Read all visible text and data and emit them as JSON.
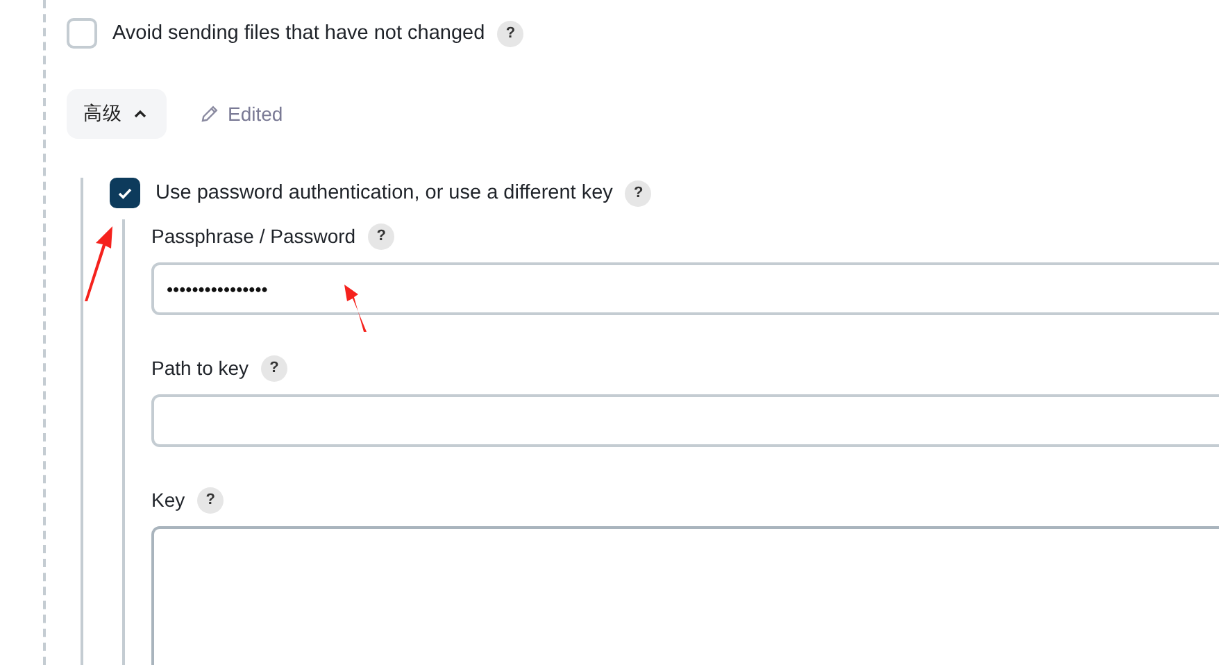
{
  "avoid_unchanged": {
    "label": "Avoid sending files that have not changed",
    "checked": false,
    "help": "?"
  },
  "advanced": {
    "label": "高级",
    "expanded": true,
    "edited": "Edited"
  },
  "password_auth": {
    "label": "Use password authentication, or use a different key",
    "checked": true,
    "help": "?"
  },
  "fields": [
    {
      "kind": "input",
      "label": "Passphrase / Password",
      "help": "?",
      "value": "••••••••••••••••"
    },
    {
      "kind": "input",
      "label": "Path to key",
      "help": "?"
    },
    {
      "kind": "textarea",
      "label": "Key",
      "help": "?"
    }
  ]
}
